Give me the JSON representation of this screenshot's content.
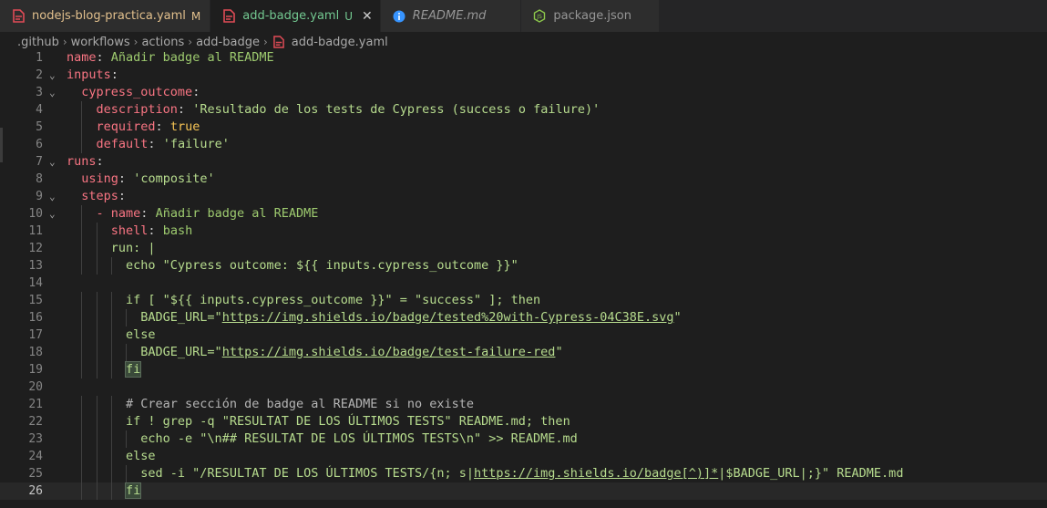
{
  "tabs": [
    {
      "label": "nodejs-blog-practica.yaml",
      "status": "M",
      "icon": "yaml-file-icon",
      "state": "modified"
    },
    {
      "label": "add-badge.yaml",
      "status": "U",
      "icon": "yaml-file-icon",
      "state": "active",
      "close": "✕"
    },
    {
      "label": "README.md",
      "status": "",
      "icon": "info-icon",
      "state": "italic"
    },
    {
      "label": "package.json",
      "status": "",
      "icon": "nodejs-icon",
      "state": "normal"
    }
  ],
  "breadcrumb": [
    ".github",
    "workflows",
    "actions",
    "add-badge",
    "add-badge.yaml"
  ],
  "current_line": 26,
  "lines": [
    "name: Añadir badge al README",
    "inputs:",
    "  cypress_outcome:",
    "    description: 'Resultado de los tests de Cypress (success o failure)'",
    "    required: true",
    "    default: 'failure'",
    "runs:",
    "  using: 'composite'",
    "  steps:",
    "    - name: Añadir badge al README",
    "      shell: bash",
    "      run: |",
    "        echo \"Cypress outcome: ${{ inputs.cypress_outcome }}\"",
    "",
    "        if [ \"${{ inputs.cypress_outcome }}\" = \"success\" ]; then",
    "          BADGE_URL=\"https://img.shields.io/badge/tested%20with-Cypress-04C38E.svg\"",
    "        else",
    "          BADGE_URL=\"https://img.shields.io/badge/test-failure-red\"",
    "        fi",
    "",
    "        # Crear sección de badge al README si no existe",
    "        if ! grep -q \"RESULTAT DE LOS ÚLTIMOS TESTS\" README.md; then",
    "          echo -e \"\\n## RESULTAT DE LOS ÚLTIMOS TESTS\\n\" >> README.md",
    "        else",
    "          sed -i \"/RESULTAT DE LOS ÚLTIMOS TESTS/{n; s|https://img.shields.io/badge[^)]*|$BADGE_URL|;}\" README.md",
    "        fi"
  ],
  "colors": {
    "background": "#1e1e1e",
    "key": "#f97583",
    "string": "#b7dc8e",
    "modified": "#e2c08d",
    "untracked": "#73c991",
    "yaml_icon": "#e04b56"
  }
}
